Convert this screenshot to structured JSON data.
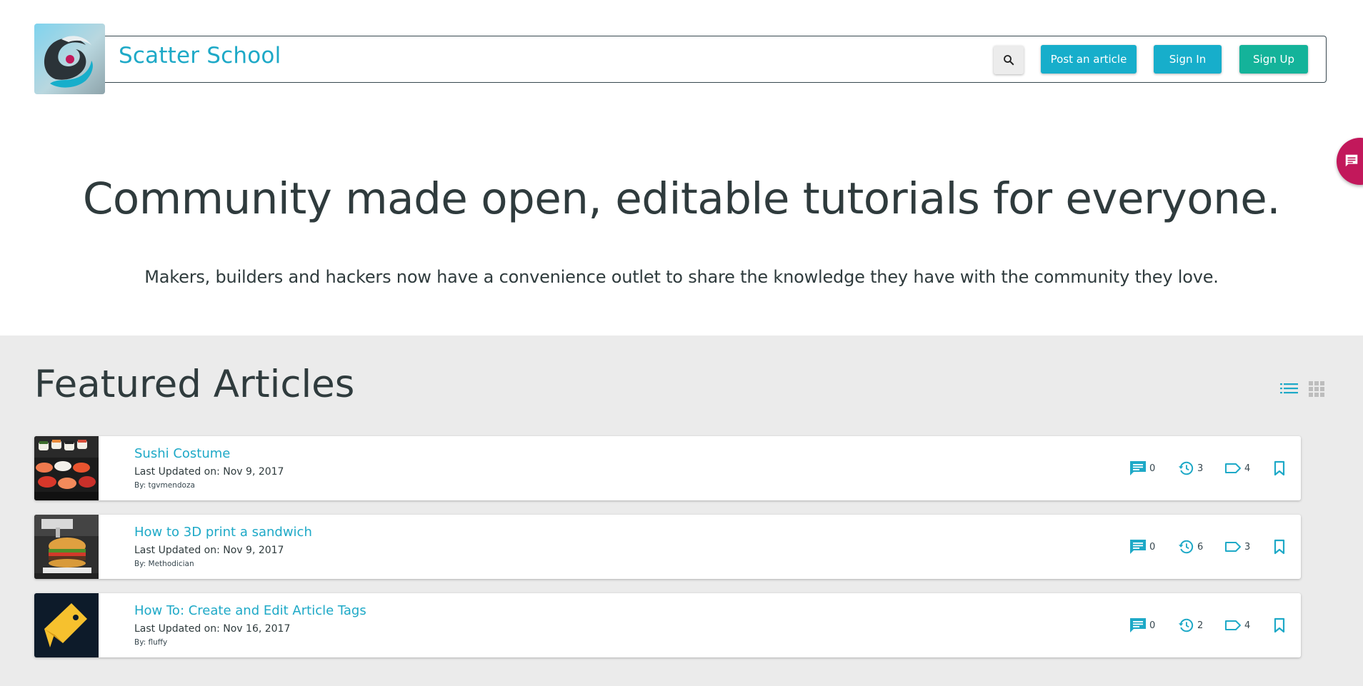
{
  "header": {
    "title": "Scatter School",
    "post_label": "Post an article",
    "signin_label": "Sign In",
    "signup_label": "Sign Up"
  },
  "hero": {
    "title": "Community made open, editable tutorials for everyone.",
    "subtitle": "Makers, builders and hackers now have a convenience outlet to share the knowledge they have with the community they love."
  },
  "featured": {
    "heading": "Featured Articles",
    "articles": [
      {
        "title": "Sushi Costume",
        "updated": "Last Updated on: Nov 9, 2017",
        "author": "By: tgvmendoza",
        "comments": "0",
        "revisions": "3",
        "tags": "4"
      },
      {
        "title": "How to 3D print a sandwich",
        "updated": "Last Updated on: Nov 9, 2017",
        "author": "By: Methodician",
        "comments": "0",
        "revisions": "6",
        "tags": "3"
      },
      {
        "title": "How To: Create and Edit Article Tags",
        "updated": "Last Updated on: Nov 16, 2017",
        "author": "By: fluffy",
        "comments": "0",
        "revisions": "2",
        "tags": "4"
      }
    ]
  },
  "colors": {
    "brand": "#1ea9c7",
    "signup": "#14b39a",
    "chat": "#c2185b",
    "text": "#2f3b3d"
  },
  "icons": [
    "search-icon",
    "chat-icon",
    "list-view-icon",
    "grid-view-icon",
    "comment-icon",
    "history-icon",
    "tag-icon",
    "bookmark-icon"
  ]
}
